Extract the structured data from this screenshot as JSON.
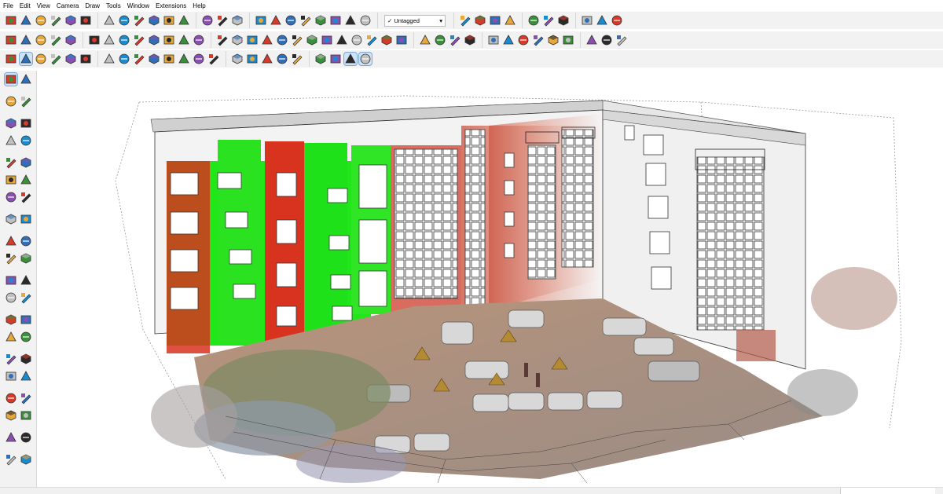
{
  "menu": [
    "File",
    "Edit",
    "View",
    "Camera",
    "Draw",
    "Tools",
    "Window",
    "Extensions",
    "Help"
  ],
  "tag_dropdown": {
    "check": "✓",
    "label": "Untagged",
    "arrow": "▾"
  },
  "icons": {
    "row1": [
      "sun-icon",
      "cloud-icon",
      "sync-icon",
      "cloud-upload-icon",
      "pencil-sketch-icon",
      "paint-icon",
      "walk-icon",
      "orbit-icon",
      "globe-icon",
      "plugin-icon",
      "plugin-icon",
      "plugin-icon",
      "play-icon",
      "document-icon",
      "stamp-icon",
      "sandbox-icon",
      "sandbox-icon",
      "sandbox-icon",
      "sandbox-icon",
      "triangle-icon",
      "sandbox-icon",
      "sandbox-icon",
      "cube-icon",
      "cube-icon",
      "box-icon",
      "prism-icon",
      "layers-icon",
      "cube-icon",
      "move-icon",
      "rotate-icon",
      "scale-icon",
      "push-pull-icon",
      "follow-me-icon"
    ],
    "row2": [
      "open-folder-icon",
      "section-icon",
      "cube-icon",
      "paint-bucket-icon",
      "undo-icon",
      "cube-icon",
      "cube-icon",
      "cube-icon",
      "cube-icon",
      "cube-icon",
      "cube-icon",
      "cube-icon",
      "cube-icon",
      "cursor-icon",
      "pin-icon",
      "arrow-icon",
      "arrow-icon",
      "paint-icon",
      "cube-icon",
      "cube-icon",
      "cube-icon",
      "cube-icon",
      "star-icon",
      "triangle-icon",
      "globe-icon",
      "zoom-icon",
      "camera-icon",
      "cube-icon",
      "home-icon",
      "bed-icon",
      "pen-icon",
      "tape-icon",
      "protractor-icon",
      "text-icon",
      "axis-icon",
      "paint-icon",
      "component-icon",
      "component-icon",
      "component-icon"
    ],
    "row3": [
      "zoom-icon",
      "select-icon",
      "eraser-icon",
      "pencil-icon",
      "arc-icon",
      "shape-icon",
      "move-icon",
      "rotate-icon",
      "pan-icon",
      "zoom-icon",
      "paint-icon",
      "section-plane-icon",
      "search-icon",
      "walk-icon",
      "cube-icon",
      "cube-icon",
      "cube-icon",
      "layers-icon",
      "settings-icon",
      "position-camera-icon",
      "cube-view-icon",
      "cube-view-icon",
      "cube-view-icon"
    ],
    "left": [
      "select-icon",
      "orbit-icon",
      "paint-bucket-icon",
      "eraser-icon",
      "component-icon",
      "pencil-icon",
      "line-icon",
      "freehand-icon",
      "rectangle-icon",
      "rotated-rectangle-icon",
      "circle-icon",
      "polygon-icon",
      "arc-icon",
      "pie-icon",
      "arc-3pt-icon",
      "offset-icon",
      "move-icon",
      "push-pull-icon",
      "rotate-icon",
      "follow-me-icon",
      "scale-icon",
      "offset-icon",
      "tape-measure-icon",
      "dimension-icon",
      "protractor-icon",
      "text-icon",
      "axes-icon",
      "3d-text-icon",
      "section-plane-icon",
      "zoom-window-icon",
      "zoom-icon",
      "zoom-extents-icon",
      "position-camera-icon",
      "look-around-icon",
      "walk-icon",
      "pan-icon",
      "sandbox-icon",
      "sandbox-icon",
      "layers-icon",
      "layers-icon"
    ]
  },
  "colors": {
    "toolbar_bg": "#f2f2f2",
    "selected": "#cfe3f8",
    "scan_green": "#22e81b",
    "scan_red": "#d8331f",
    "facade": "#f4f4f4"
  }
}
